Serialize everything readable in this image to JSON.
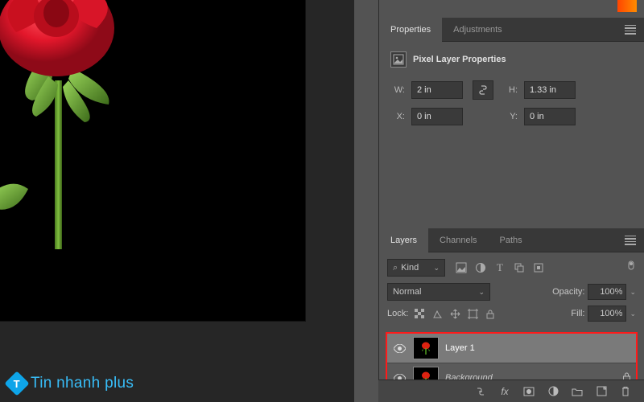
{
  "canvas": {
    "watermark_text": "Tin nhanh plus",
    "watermark_badge": "T"
  },
  "properties_panel": {
    "tabs": {
      "properties": "Properties",
      "adjustments": "Adjustments"
    },
    "title": "Pixel Layer Properties",
    "fields": {
      "w_label": "W:",
      "w_value": "2 in",
      "h_label": "H:",
      "h_value": "1.33 in",
      "x_label": "X:",
      "x_value": "0 in",
      "y_label": "Y:",
      "y_value": "0 in"
    }
  },
  "layers_panel": {
    "tabs": {
      "layers": "Layers",
      "channels": "Channels",
      "paths": "Paths"
    },
    "kind_label": "Kind",
    "blend_mode": "Normal",
    "opacity_label": "Opacity:",
    "opacity_value": "100%",
    "lock_label": "Lock:",
    "fill_label": "Fill:",
    "fill_value": "100%",
    "layers": [
      {
        "name": "Layer 1",
        "italic": false,
        "selected": true,
        "locked": false
      },
      {
        "name": "Background",
        "italic": true,
        "selected": false,
        "locked": true
      }
    ],
    "footer_icons": [
      "link",
      "fx",
      "mask",
      "adjustment",
      "group",
      "new",
      "trash"
    ]
  }
}
